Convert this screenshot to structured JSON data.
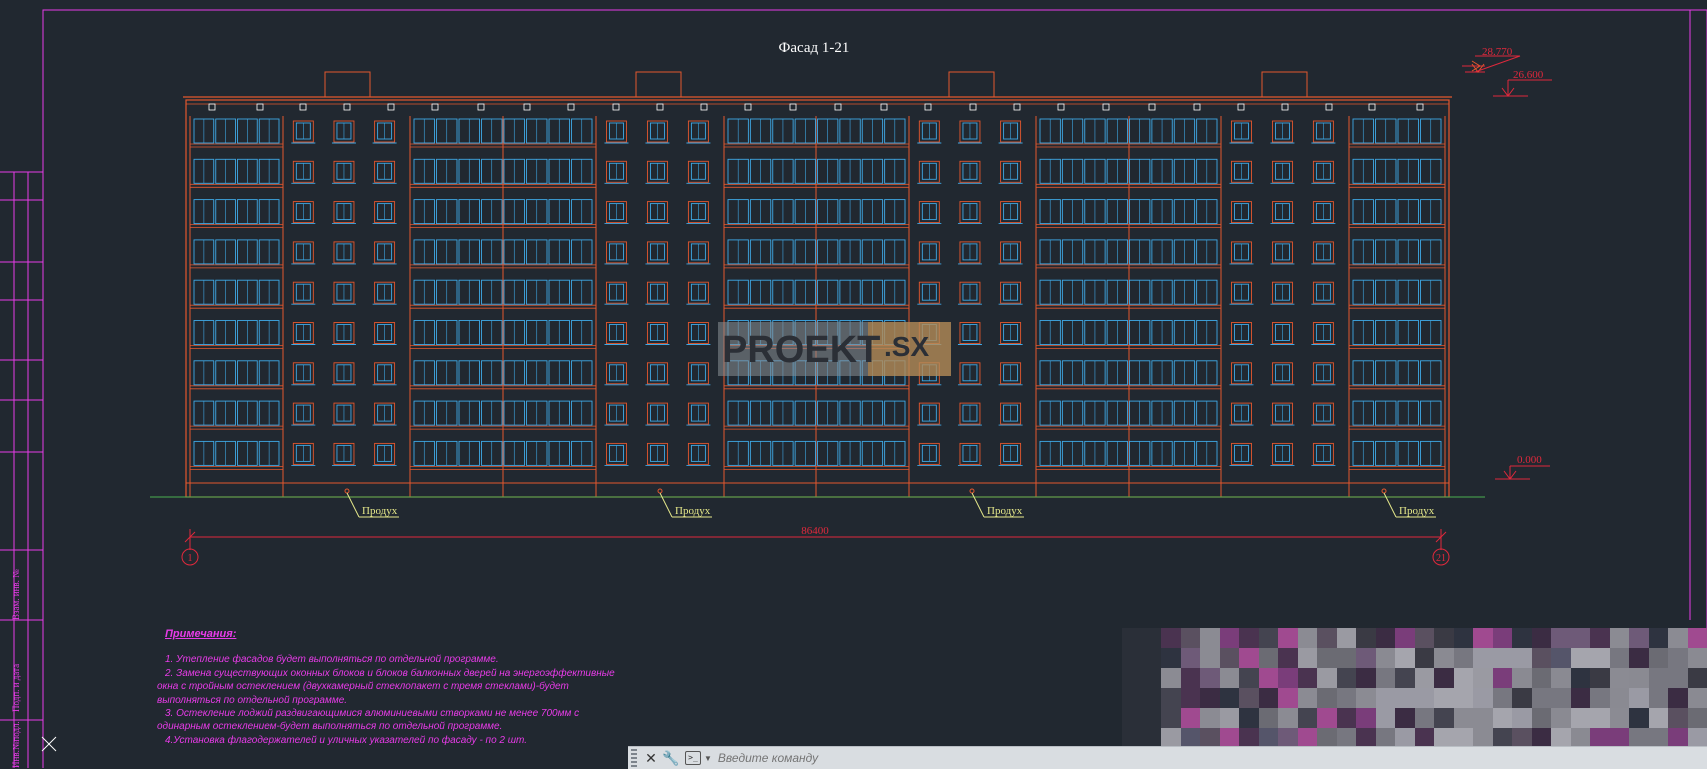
{
  "drawing": {
    "title": "Фасад 1-21",
    "elevations": [
      "28.770",
      "26.600",
      "0.000"
    ],
    "dimension": "86400",
    "axes": [
      "1",
      "21"
    ],
    "vent_label": "Продух",
    "watermark": {
      "main": "PROEKT",
      "suffix": ".SX"
    },
    "stamp_labels": [
      "Взам. инв. №",
      "Подп. и дата",
      "Инв.№подл."
    ]
  },
  "notes": {
    "title": "Примечания:",
    "lines": [
      "1. Утепление фасадов будет выполняться по отдельной программе.",
      "2. Замена существующих оконных блоков и блоков балконных дверей на энергоэффективные",
      "окна с тройным остеклением (двухкамерный стеклопакет с тремя стеклами)-будет",
      "выполняться по отдельной программе.",
      "3. Остекление лоджий раздвигающимися алюминиевыми створками не менее 700мм с",
      "одинарным остеклением-будет выполняться по отдельной программе.",
      "4.Установка флагодержателей и уличных указателей по фасаду - по 2 шт."
    ]
  },
  "command_line": {
    "placeholder": "Введите команду",
    "close_icon": "close-icon",
    "settings_icon": "wrench-icon",
    "prompt_icon": "command-prompt-icon"
  },
  "colors": {
    "background": "#212830",
    "facade": "#e4572e",
    "windows": "#3fa9e6",
    "magenta": "#e83be8",
    "dimension": "#e0283c",
    "ground": "#4caf50",
    "label": "#e6e98a"
  }
}
